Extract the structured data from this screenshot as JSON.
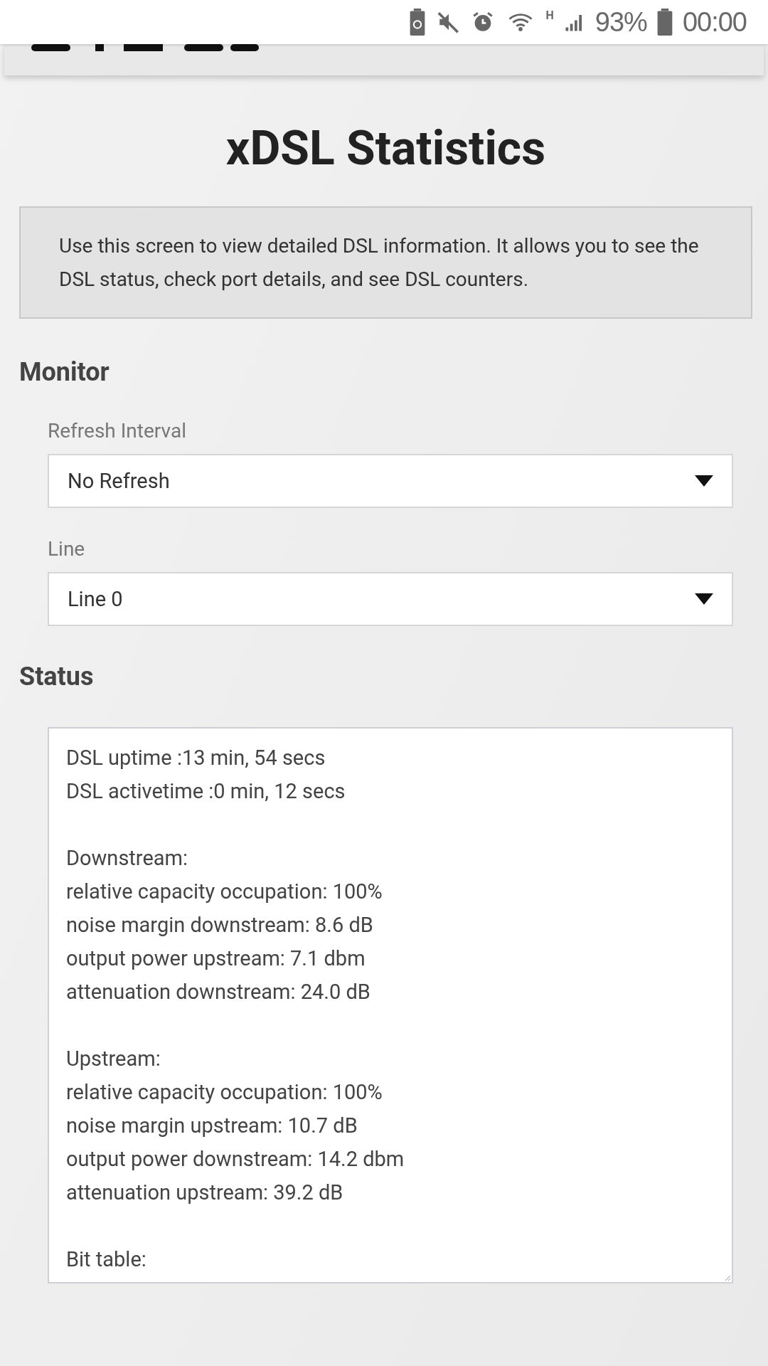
{
  "status_bar": {
    "network_type": "H",
    "battery": "93%",
    "time": "00:00"
  },
  "title": "xDSL Statistics",
  "description": "Use this screen to view detailed DSL information. It allows you to see the DSL status, check port details, and see DSL counters.",
  "monitor": {
    "heading": "Monitor",
    "fields": [
      {
        "label": "Refresh Interval",
        "value": "No Refresh"
      },
      {
        "label": "Line",
        "value": "Line 0"
      }
    ]
  },
  "status": {
    "heading": "Status",
    "groups": [
      [
        "DSL uptime :13 min, 54 secs",
        "DSL activetime :0 min, 12 secs"
      ],
      [
        "Downstream:",
        "relative capacity occupation: 100%",
        "noise margin downstream: 8.6 dB",
        "output power upstream: 7.1 dbm",
        "attenuation downstream: 24.0 dB"
      ],
      [
        "Upstream:",
        "relative capacity occupation: 100%",
        "noise margin upstream: 10.7 dB",
        "output power downstream: 14.2 dbm",
        "attenuation upstream: 39.2 dB"
      ],
      [
        "Bit table:"
      ]
    ]
  }
}
